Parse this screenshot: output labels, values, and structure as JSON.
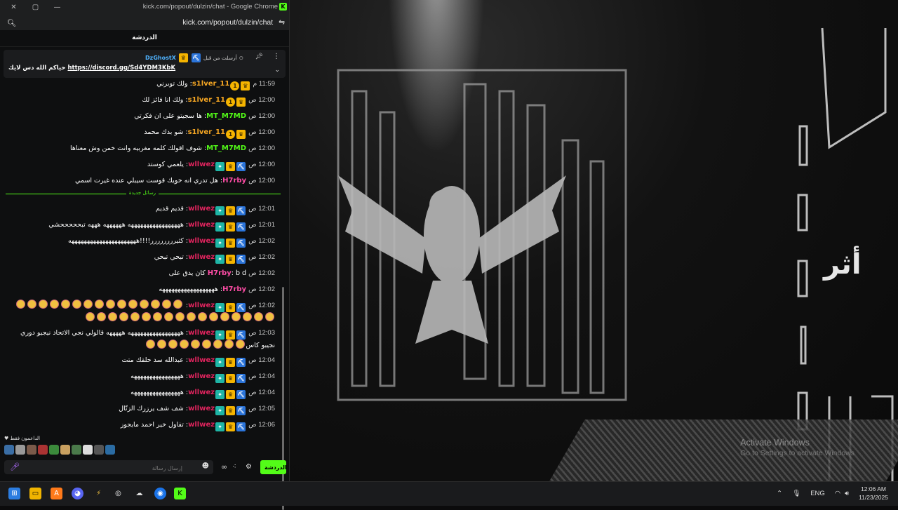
{
  "browser": {
    "title": "kick.com/popout/dulzin/chat - Google Chrome",
    "url": "kick.com/popout/dulzin/chat",
    "controls": [
      "✕",
      "▢",
      "—"
    ],
    "favicon": "K"
  },
  "chat": {
    "header": "الدردشة",
    "pinned": {
      "sent_by": "أرسلت من قبل",
      "username": "DzGhostX",
      "message_prefix": "حياكم الله دس لايك",
      "link": "https://discord.gg/Sd4YDM3KbK"
    },
    "divider_label": "رسائل جديدة",
    "messages": [
      {
        "time": "11:59 م",
        "user": "s1lver_11",
        "user_color": "#f5a623",
        "badges": [
          "crown",
          "one"
        ],
        "text": "ولك توبرني"
      },
      {
        "time": "12:00 ص",
        "user": "s1lver_11",
        "user_color": "#f5a623",
        "badges": [
          "crown",
          "one"
        ],
        "text": "ولك انا فائز لك"
      },
      {
        "time": "12:00 ص",
        "user": "MT_M7MD",
        "user_color": "#53fc18",
        "badges": [],
        "text": "ها سجيتو على ان فكرتي"
      },
      {
        "time": "12:00 ص",
        "user": "s1lver_11",
        "user_color": "#f5a623",
        "badges": [
          "crown",
          "one"
        ],
        "text": "شو بدك محمد"
      },
      {
        "time": "12:00 ص",
        "user": "MT_M7MD",
        "user_color": "#53fc18",
        "badges": [],
        "text": "شوف اقولك كلمه مغربيه وانت خمن وش معناها"
      },
      {
        "time": "12:00 ص",
        "user": "wllwez",
        "user_color": "#e0245e",
        "badges": [
          "pick",
          "crown",
          "sub"
        ],
        "text": "يلعمي كوستد"
      },
      {
        "time": "12:00 ص",
        "user": "H7rby",
        "user_color": "#ff4da6",
        "badges": [],
        "text": "هل تدري انه خويك قوست سيبلي عنده غيرت اسمي"
      },
      {
        "time": "12:01 ص",
        "user": "wllwez",
        "user_color": "#e0245e",
        "badges": [
          "pick",
          "crown",
          "sub"
        ],
        "text": "قديم قديم"
      },
      {
        "time": "12:01 ص",
        "user": "wllwez",
        "user_color": "#e0245e",
        "badges": [
          "pick",
          "crown",
          "sub"
        ],
        "text": "هههههههههههههههههه ههههههه هههه تبحححححشي"
      },
      {
        "time": "12:02 ص",
        "user": "wllwez",
        "user_color": "#e0245e",
        "badges": [
          "pick",
          "crown",
          "sub"
        ],
        "text": "كثيرررررررر!!!!ههههههههههههههههههههههه"
      },
      {
        "time": "12:02 ص",
        "user": "wllwez",
        "user_color": "#e0245e",
        "badges": [
          "pick",
          "crown",
          "sub"
        ],
        "text": "تبحي تبحي"
      },
      {
        "time": "12:02 ص",
        "user": "H7rby",
        "user_color": "#ff4da6",
        "badges": [],
        "text": "b d كان يدق على"
      },
      {
        "time": "12:02 ص",
        "user": "H7rby",
        "user_color": "#ff4da6",
        "badges": [],
        "text": "ههههههههههههههههههه"
      },
      {
        "time": "12:02 ص",
        "user": "wllwez",
        "user_color": "#e0245e",
        "badges": [
          "pick",
          "crown",
          "sub"
        ],
        "text": "",
        "emotes": 32
      },
      {
        "time": "12:03 ص",
        "user": "wllwez",
        "user_color": "#e0245e",
        "badges": [
          "pick",
          "crown",
          "sub"
        ],
        "text": "هههههههههههههههههه هههههه قالولي نجي الاتحاد نيجيو دوري نجيبو كاس",
        "emotes": 9
      },
      {
        "time": "12:04 ص",
        "user": "wllwez",
        "user_color": "#e0245e",
        "badges": [
          "pick",
          "crown",
          "sub"
        ],
        "text": "عبدالله سد حلقك متت"
      },
      {
        "time": "12:04 ص",
        "user": "wllwez",
        "user_color": "#e0245e",
        "badges": [
          "pick",
          "crown",
          "sub"
        ],
        "text": "ههههههههههههههههه"
      },
      {
        "time": "12:04 ص",
        "user": "wllwez",
        "user_color": "#e0245e",
        "badges": [
          "pick",
          "crown",
          "sub"
        ],
        "text": "ههههههههههههههههه"
      },
      {
        "time": "12:05 ص",
        "user": "wllwez",
        "user_color": "#e0245e",
        "badges": [
          "pick",
          "crown",
          "sub"
        ],
        "text": "شف شف يرزرك الزتّال"
      },
      {
        "time": "12:06 ص",
        "user": "wllwez",
        "user_color": "#e0245e",
        "badges": [
          "pick",
          "crown",
          "sub"
        ],
        "text": "تفاول خير احمد مايجوز"
      }
    ],
    "supporters_label": "الداعمون فقط",
    "input_placeholder": "إرسال رسالة",
    "send_label": "الدردشة"
  },
  "desktop": {
    "watermark_title": "Activate Windows",
    "watermark_sub": "Go to Settings to activate Windows"
  },
  "taskbar": {
    "language": "ENG",
    "time": "12:06 AM",
    "date": "11/23/2025"
  }
}
